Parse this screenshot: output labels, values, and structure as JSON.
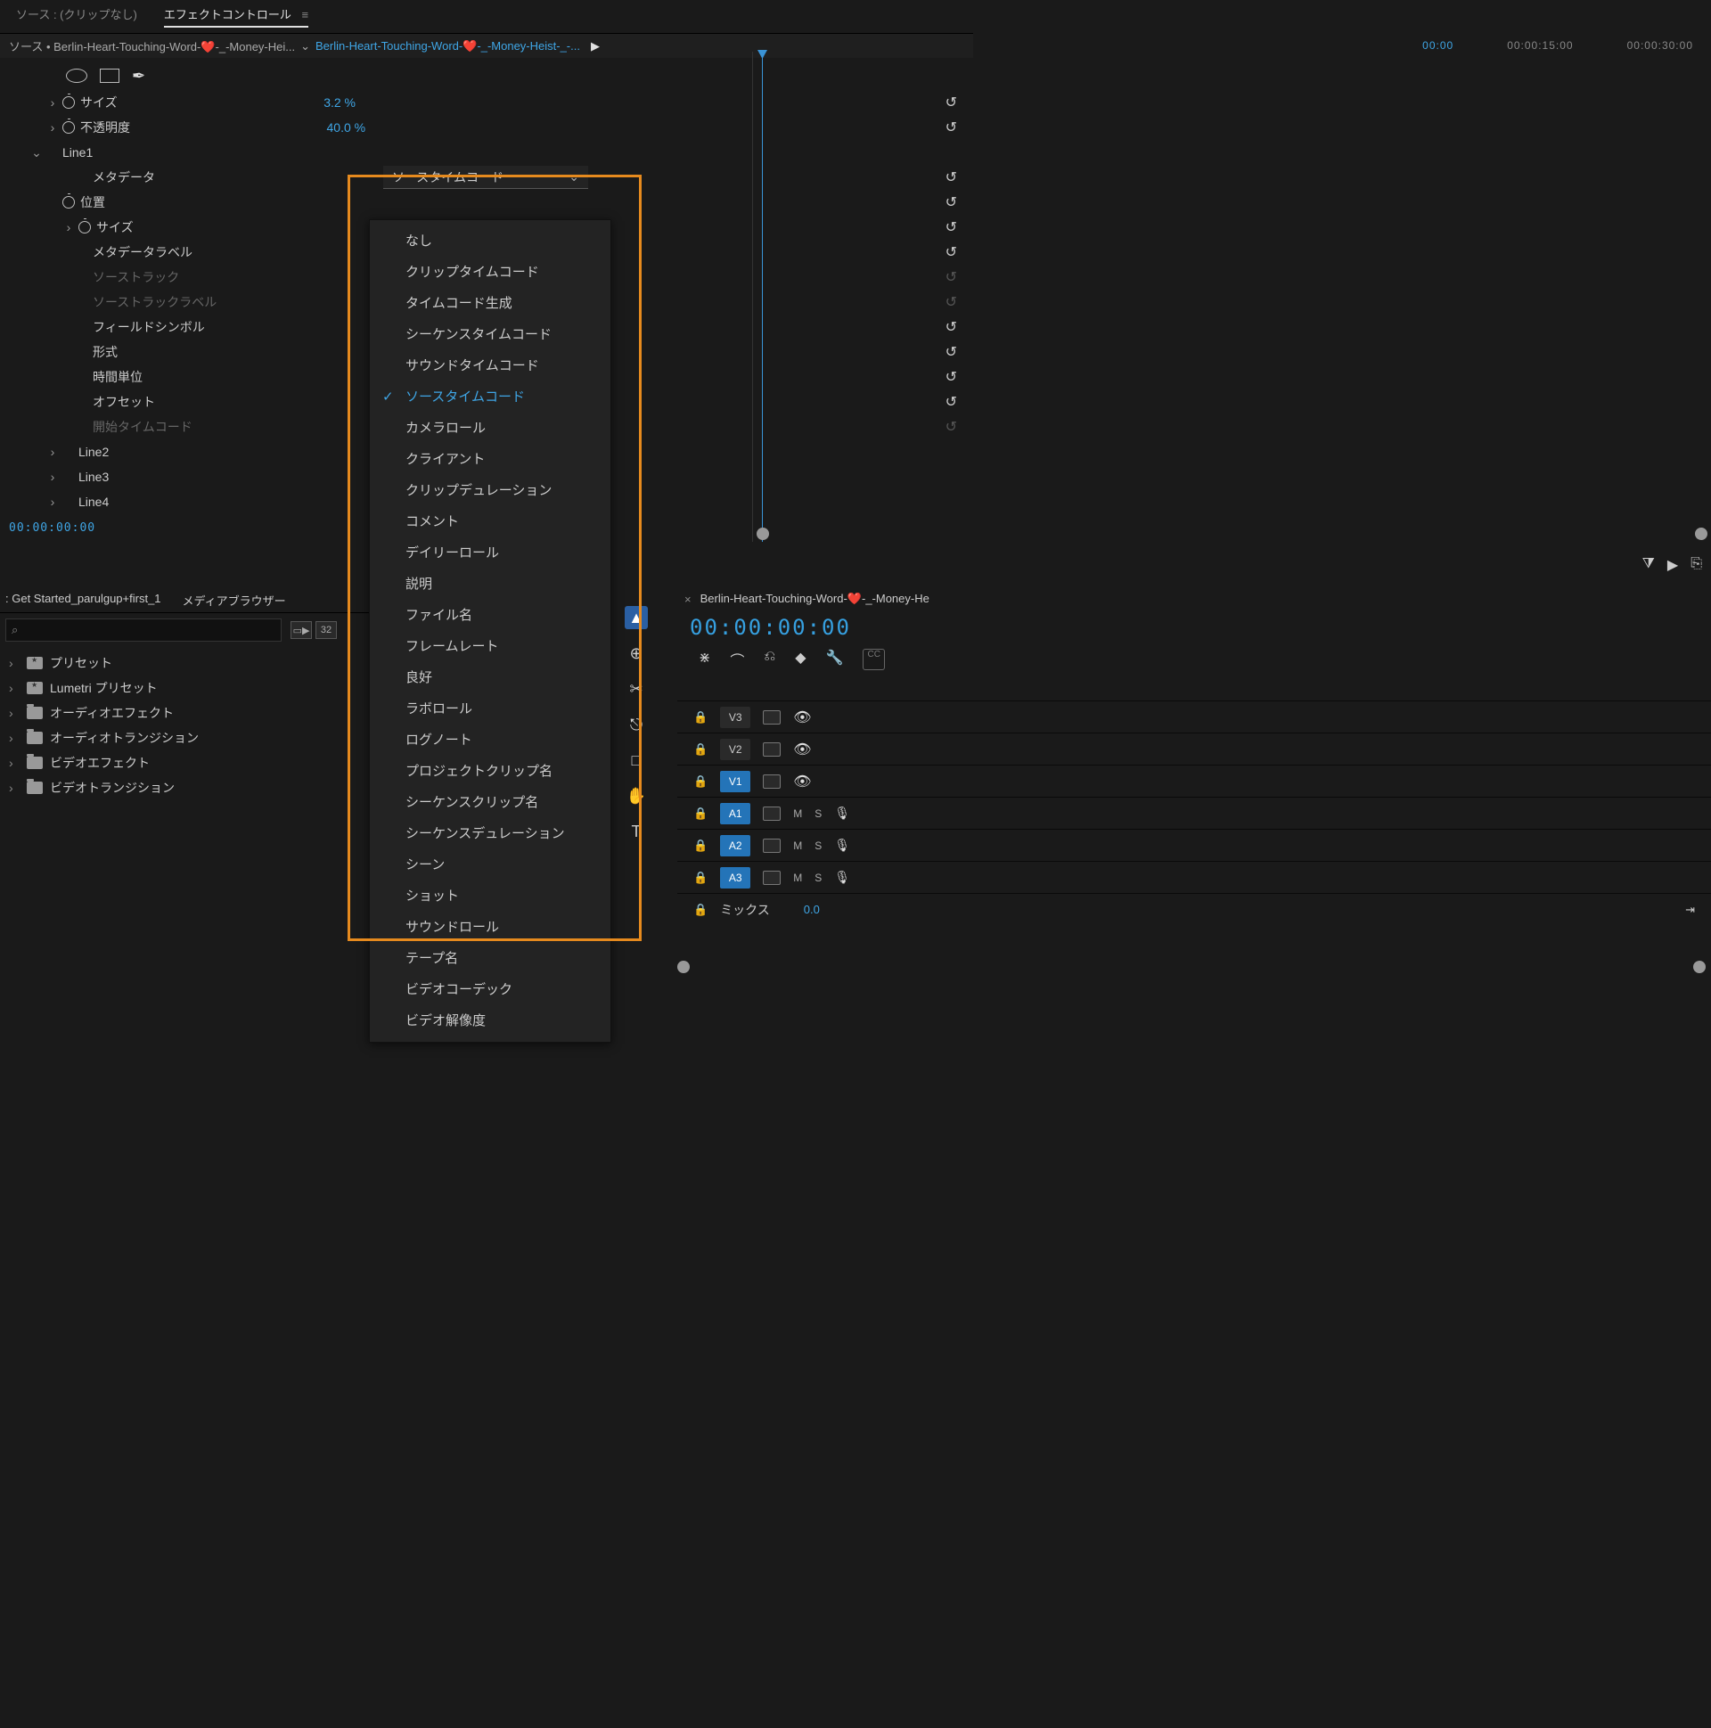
{
  "tabs": {
    "source": "ソース : (クリップなし)",
    "effectControls": "エフェクトコントロール",
    "hamburger": "≡"
  },
  "sourceBar": {
    "src1": "ソース • Berlin-Heart-Touching-Word-❤️-_-Money-Hei...",
    "chev": "⌄",
    "src2": "Berlin-Heart-Touching-Word-❤️-_-Money-Heist-_-...",
    "play": "▶"
  },
  "rulerTimes": [
    "00:00",
    "00:00:15:00",
    "00:00:30:00"
  ],
  "shapeRow": {
    "penGlyph": "✒"
  },
  "props": {
    "size": {
      "label": "サイズ",
      "value": "3.2 %"
    },
    "opacity": {
      "label": "不透明度",
      "value": "40.0 %"
    },
    "line1": "Line1",
    "metadata": "メタデータ",
    "position": "位置",
    "size2": "サイズ",
    "metadataLabel": "メタデータラベル",
    "sourceTrack": "ソーストラック",
    "sourceTrackLabel": "ソーストラックラベル",
    "fieldSymbol": "フィールドシンボル",
    "format": "形式",
    "timeUnit": "時間単位",
    "offset": "オフセット",
    "startTimecode": "開始タイムコード",
    "line2": "Line2",
    "line3": "Line3",
    "line4": "Line4"
  },
  "ddSelected": "ソースタイムコード",
  "ddOptions": [
    "なし",
    "クリップタイムコード",
    "タイムコード生成",
    "シーケンスタイムコード",
    "サウンドタイムコード",
    "ソースタイムコード",
    "カメラロール",
    "クライアント",
    "クリップデュレーション",
    "コメント",
    "デイリーロール",
    "説明",
    "ファイル名",
    "フレームレート",
    "良好",
    "ラボロール",
    "ログノート",
    "プロジェクトクリップ名",
    "シーケンスクリップ名",
    "シーケンスデュレーション",
    "シーン",
    "ショット",
    "サウンドロール",
    "テープ名",
    "ビデオコーデック",
    "ビデオ解像度"
  ],
  "tcReadout": "00:00:00:00",
  "bottomLeft": {
    "tab1": ": Get Started_parulgup+first_1",
    "tab2": "メディアブラウザー",
    "searchGlyph": "⌕",
    "tree": [
      "プリセット",
      "Lumetri プリセット",
      "オーディオエフェクト",
      "オーディオトランジション",
      "ビデオエフェクト",
      "ビデオトランジション"
    ]
  },
  "tools": [
    "▲",
    "⊕",
    "✂",
    "⎋",
    "□",
    "✋",
    "T"
  ],
  "timeline": {
    "close": "×",
    "name": "Berlin-Heart-Touching-Word-❤️-_-Money-He",
    "bigtc": "00:00:00:00",
    "iconRow": [
      "⋇",
      "⌒",
      "⎌",
      "◆",
      "🔧"
    ],
    "cc": "CC",
    "videoTracks": [
      {
        "name": "V3",
        "blue": false
      },
      {
        "name": "V2",
        "blue": false
      },
      {
        "name": "V1",
        "blue": true
      }
    ],
    "audioTracks": [
      {
        "name": "A1",
        "blue": true
      },
      {
        "name": "A2",
        "blue": true
      },
      {
        "name": "A3",
        "blue": true
      }
    ],
    "mix": {
      "label": "ミックス",
      "value": "0.0",
      "toend": "⇥"
    }
  },
  "botIcons": [
    "⧩",
    "▶",
    "⎘"
  ],
  "trashRow": [
    "▦",
    "🗑"
  ]
}
